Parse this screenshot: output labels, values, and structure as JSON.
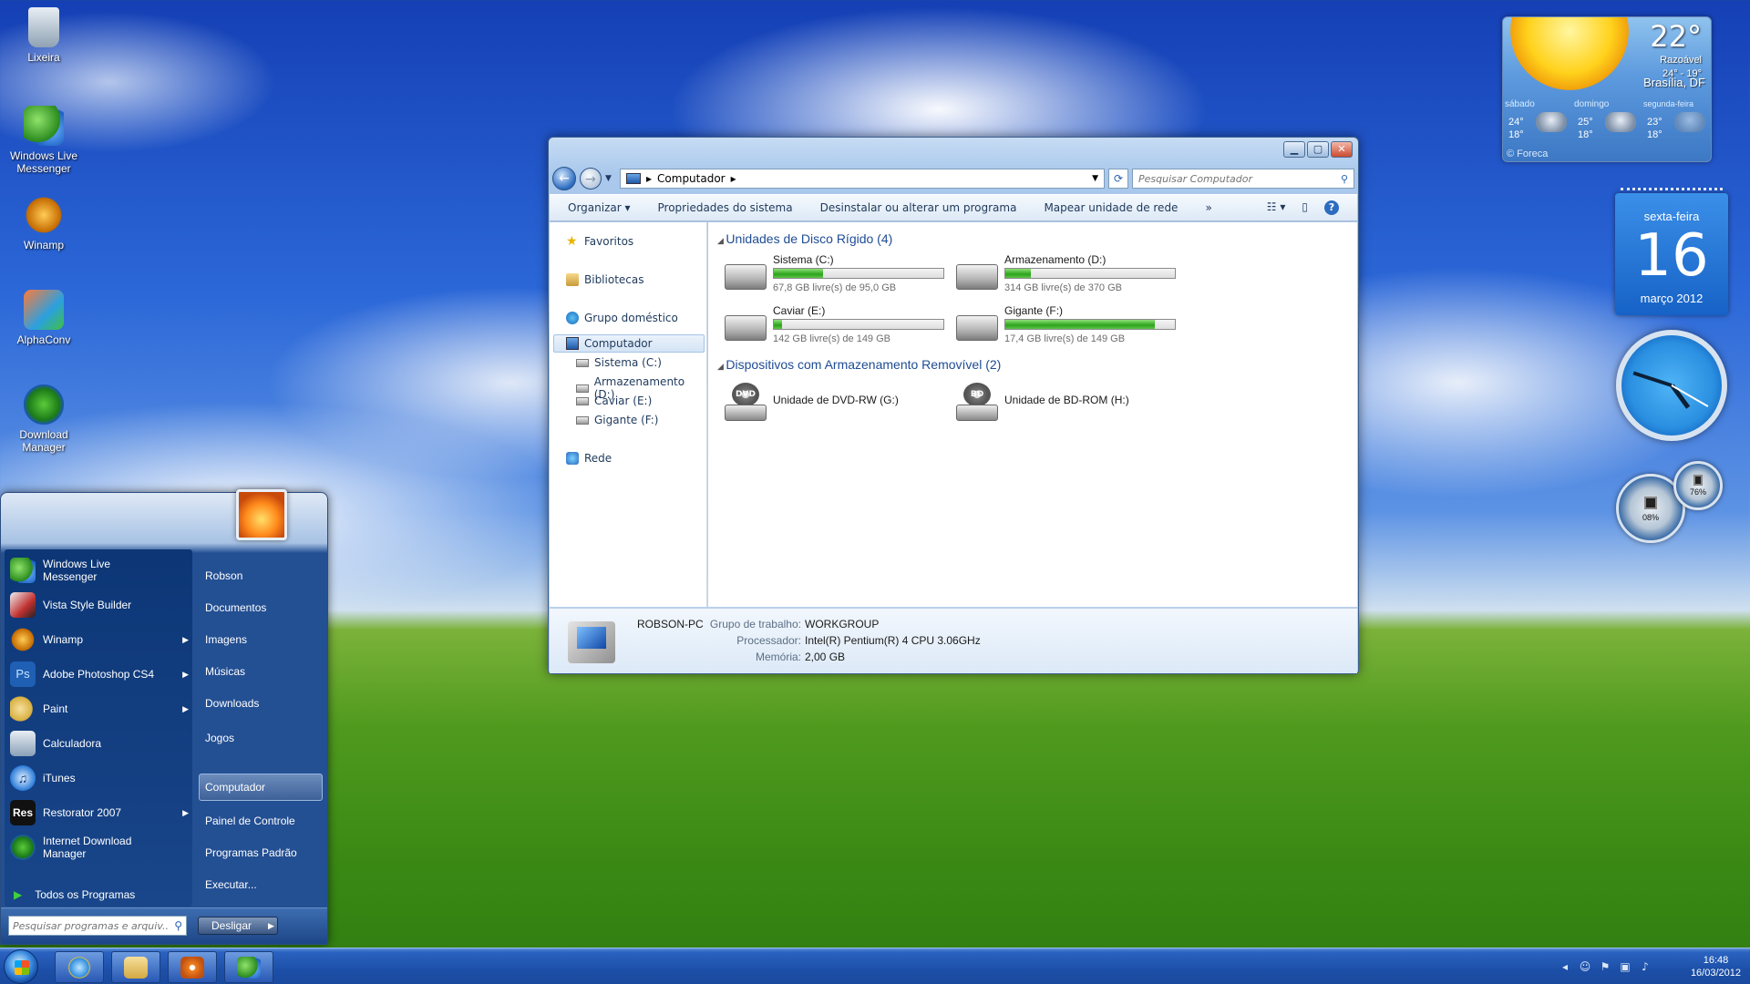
{
  "desktop": {
    "icons": [
      {
        "label": "Lixeira"
      },
      {
        "label": "Windows Live Messenger"
      },
      {
        "label": "Winamp"
      },
      {
        "label": "AlphaConv"
      },
      {
        "label": "Download Manager"
      }
    ]
  },
  "explorer": {
    "address": {
      "location": "Computador"
    },
    "search_placeholder": "Pesquisar Computador",
    "toolbar": {
      "organize": "Organizar",
      "properties": "Propriedades do sistema",
      "uninstall": "Desinstalar ou alterar um programa",
      "map_drive": "Mapear unidade de rede",
      "more": "»"
    },
    "nav": {
      "favorites": "Favoritos",
      "libraries": "Bibliotecas",
      "homegroup": "Grupo doméstico",
      "computer": "Computador",
      "drives": [
        "Sistema (C:)",
        "Armazenamento (D:)",
        "Caviar (E:)",
        "Gigante (F:)"
      ],
      "network": "Rede"
    },
    "hard_disks": {
      "heading": "Unidades de Disco Rígido (4)",
      "items": [
        {
          "name": "Sistema (C:)",
          "free_text": "67,8 GB livre(s) de 95,0 GB",
          "used_fraction": 0.29
        },
        {
          "name": "Armazenamento (D:)",
          "free_text": "314 GB livre(s) de 370 GB",
          "used_fraction": 0.15
        },
        {
          "name": "Caviar (E:)",
          "free_text": "142 GB livre(s) de 149 GB",
          "used_fraction": 0.05
        },
        {
          "name": "Gigante (F:)",
          "free_text": "17,4 GB livre(s) de 149 GB",
          "used_fraction": 0.88
        }
      ]
    },
    "removable": {
      "heading": "Dispositivos com Armazenamento Removível (2)",
      "items": [
        {
          "name": "Unidade de DVD-RW (G:)",
          "badge": "DVD"
        },
        {
          "name": "Unidade de BD-ROM (H:)",
          "badge": "BD"
        }
      ]
    },
    "details": {
      "pc_name": "ROBSON-PC",
      "workgroup_label": "Grupo de trabalho:",
      "workgroup": "WORKGROUP",
      "processor_label": "Processador:",
      "processor": "Intel(R) Pentium(R) 4 CPU 3.06GHz",
      "memory_label": "Memória:",
      "memory": "2,00 GB"
    }
  },
  "start_menu": {
    "programs": [
      {
        "label": "Windows Live Messenger",
        "submenu": false,
        "color": "#3aa03a"
      },
      {
        "label": "Vista Style Builder",
        "submenu": false,
        "color": "#c03030"
      },
      {
        "label": "Winamp",
        "submenu": true,
        "color": "#e08a10"
      },
      {
        "label": "Adobe Photoshop CS4",
        "submenu": true,
        "color": "#1f5fb4"
      },
      {
        "label": "Paint",
        "submenu": true,
        "color": "#d8b040"
      },
      {
        "label": "Calculadora",
        "submenu": false,
        "color": "#8aa0b8"
      },
      {
        "label": "iTunes",
        "submenu": false,
        "color": "#2a7ad8"
      },
      {
        "label": "Restorator 2007",
        "submenu": true,
        "color": "#b01818"
      },
      {
        "label": "Internet Download Manager",
        "submenu": false,
        "color": "#3aa03a"
      }
    ],
    "ps_badge": "Ps",
    "res_badge": "Res",
    "all_programs": "Todos os Programas",
    "places": [
      "Robson",
      "Documentos",
      "Imagens",
      "Músicas",
      "Downloads",
      "Jogos",
      "Computador",
      "Painel de Controle",
      "Programas Padrão",
      "Executar..."
    ],
    "search_placeholder": "Pesquisar programas e arquiv...",
    "shutdown": "Desligar"
  },
  "taskbar": {
    "clock_time": "16:48",
    "clock_date": "16/03/2012"
  },
  "gadgets": {
    "weather": {
      "temp": "22°",
      "condition": "Razoável",
      "range": "24° - 19°",
      "city": "Brasília, DF",
      "forecast": [
        {
          "day": "sábado",
          "high": "24°",
          "low": "18°"
        },
        {
          "day": "domingo",
          "high": "25°",
          "low": "18°"
        },
        {
          "day": "segunda-feira",
          "high": "23°",
          "low": "18°"
        }
      ],
      "source": "© Foreca"
    },
    "calendar": {
      "weekday": "sexta-feira",
      "day": "16",
      "month_year": "março 2012"
    },
    "meters": {
      "cpu": "08%",
      "ram": "76%"
    }
  }
}
